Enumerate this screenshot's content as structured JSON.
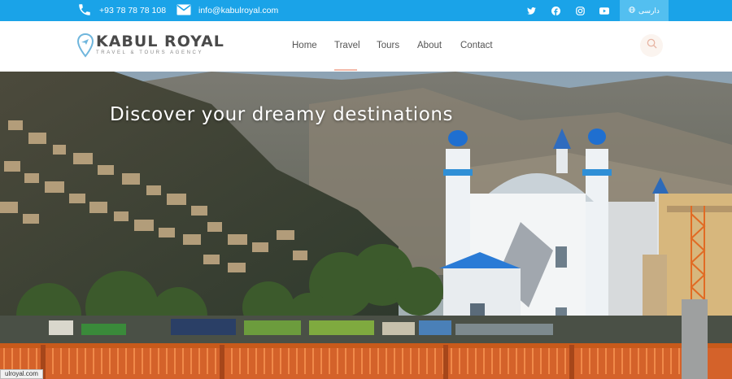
{
  "topbar": {
    "phone": "+93 78 78 78 108",
    "email": "info@kabulroyal.com",
    "language_label": "دارسی",
    "social": [
      "twitter-icon",
      "facebook-icon",
      "instagram-icon",
      "youtube-icon"
    ],
    "background_color": "#1aa3e8"
  },
  "header": {
    "brand_name": "KABUL ROYAL",
    "brand_tagline": "TRAVEL & TOURS AGENCY",
    "nav": [
      "Home",
      "Travel",
      "Tours",
      "About",
      "Contact"
    ],
    "active_nav": "Travel",
    "search_icon": "search-icon"
  },
  "hero": {
    "heading": "Discover your dreamy destinations",
    "status_url": "ulroyal.com"
  }
}
